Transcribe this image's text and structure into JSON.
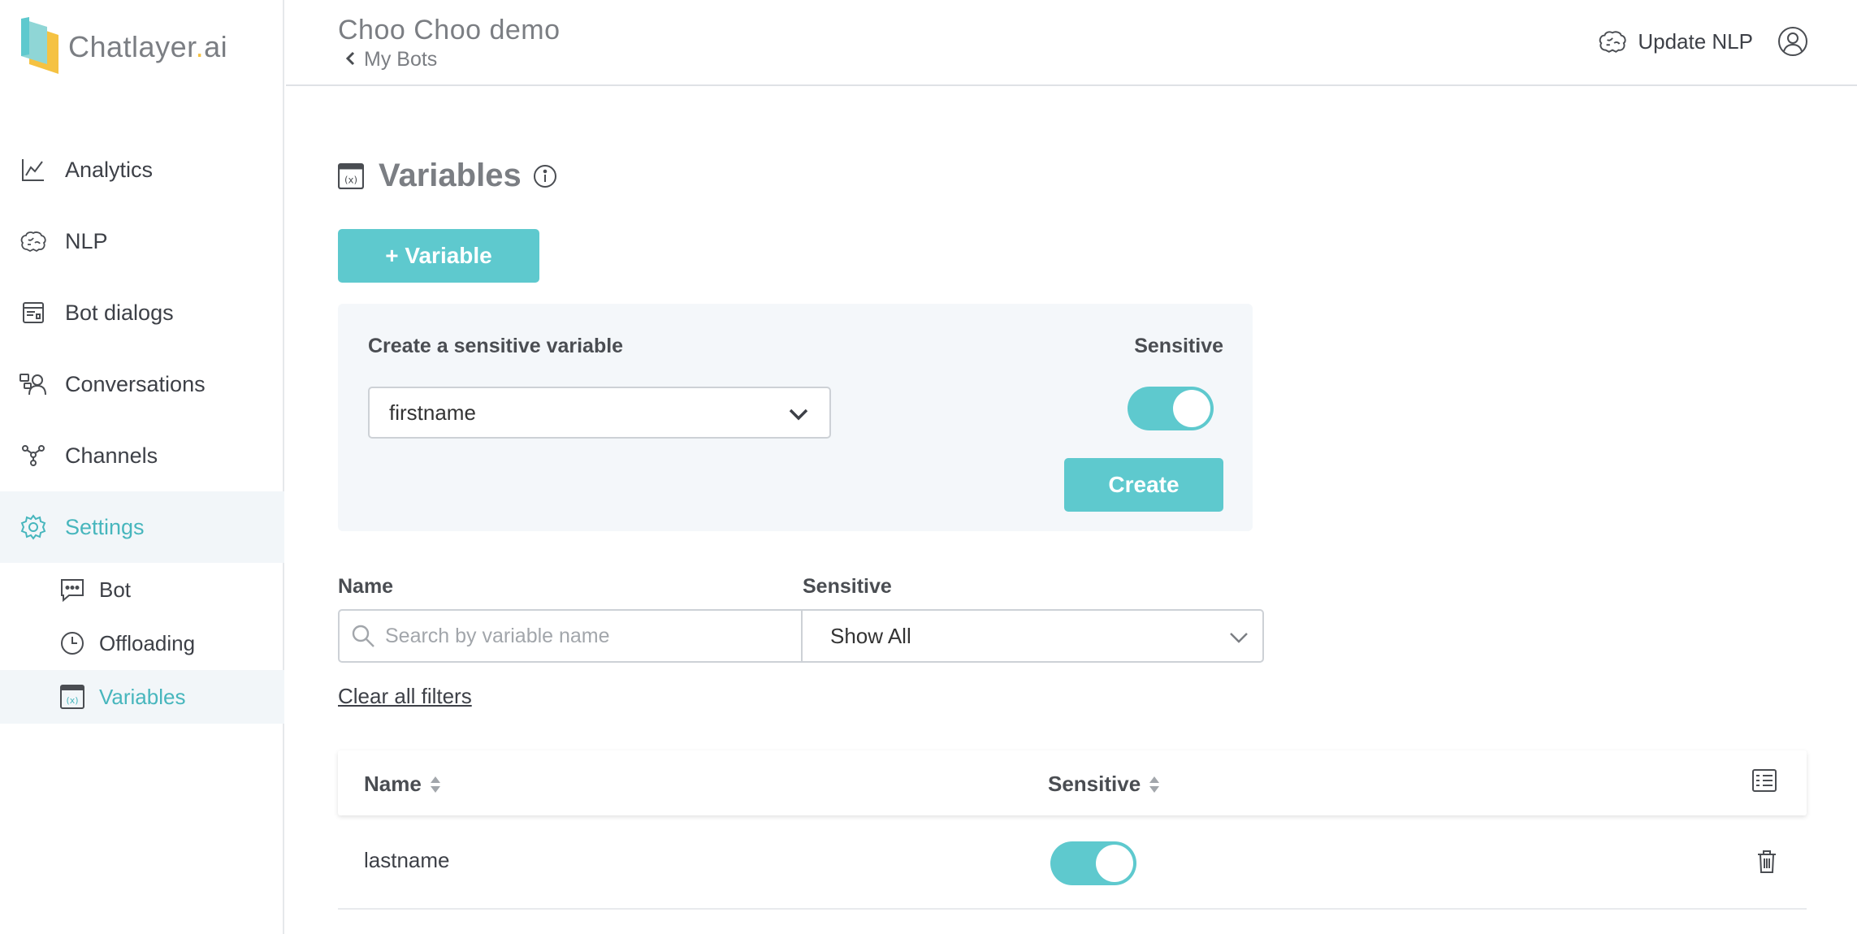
{
  "brand": {
    "name": "Chatlayer",
    "dot": ".",
    "suffix": "ai"
  },
  "sidebar": {
    "items": [
      {
        "label": "Analytics",
        "icon": "chart-line-icon"
      },
      {
        "label": "NLP",
        "icon": "brain-icon"
      },
      {
        "label": "Bot dialogs",
        "icon": "bot-dialogs-icon"
      },
      {
        "label": "Conversations",
        "icon": "conversations-icon"
      },
      {
        "label": "Channels",
        "icon": "channels-icon"
      },
      {
        "label": "Settings",
        "icon": "gear-icon",
        "active": true
      }
    ],
    "subitems": [
      {
        "label": "Bot",
        "icon": "chat-bubble-icon"
      },
      {
        "label": "Offloading",
        "icon": "clock-icon"
      },
      {
        "label": "Variables",
        "icon": "variable-icon",
        "active": true
      }
    ]
  },
  "header": {
    "bot_title": "Choo Choo demo",
    "back_link": "My Bots",
    "update_nlp": "Update NLP"
  },
  "page": {
    "title": "Variables",
    "add_variable": "+ Variable"
  },
  "sensitive_panel": {
    "label": "Create a sensitive variable",
    "sensitive_label": "Sensitive",
    "selected_variable": "firstname",
    "sensitive_on": true,
    "create_button": "Create"
  },
  "filters": {
    "name_label": "Name",
    "sensitive_label": "Sensitive",
    "search_placeholder": "Search by variable name",
    "sensitive_selected": "Show All",
    "clear": "Clear all filters"
  },
  "table": {
    "columns": [
      "Name",
      "Sensitive"
    ],
    "rows": [
      {
        "name": "lastname",
        "sensitive": true
      }
    ]
  },
  "colors": {
    "accent": "#5ec9ce",
    "active_text": "#47b6bd",
    "active_bg": "#f2f6f9"
  }
}
